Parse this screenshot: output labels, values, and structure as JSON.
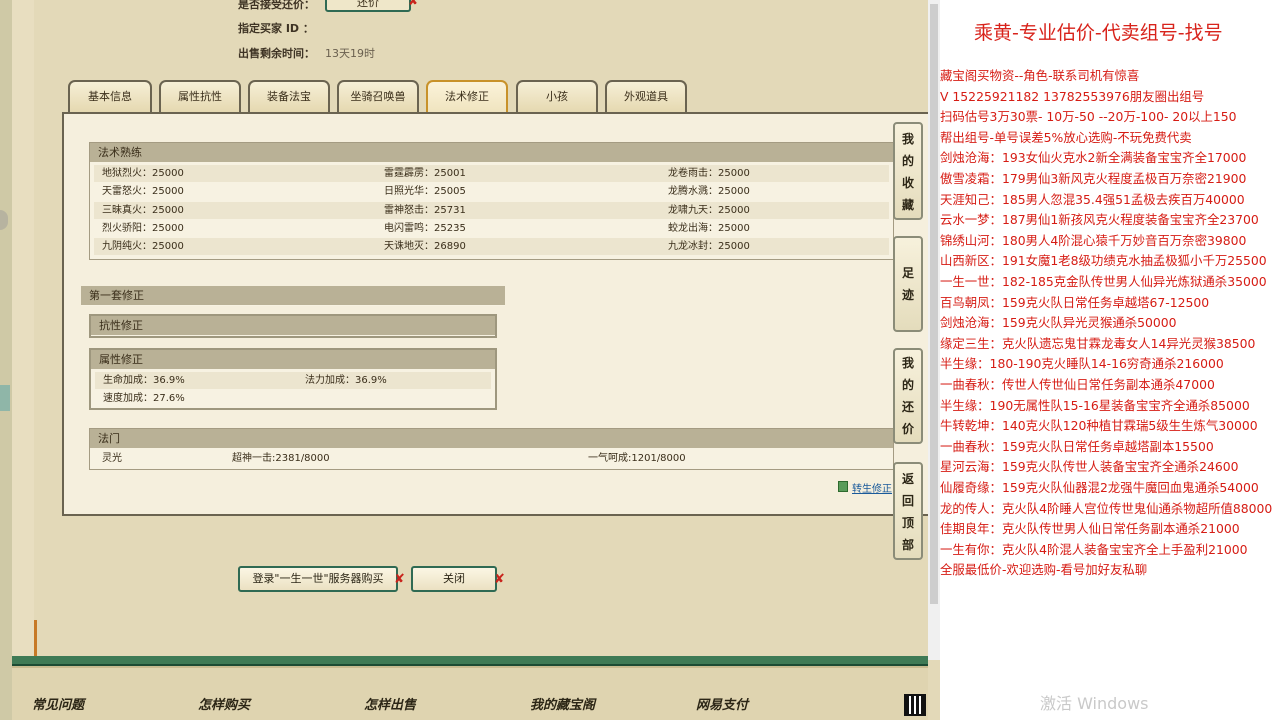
{
  "listing": {
    "accept_counter_label": "是否接受还价：",
    "counter_button": "还价",
    "buyer_id_label": "指定买家 ID ：",
    "time_left_label": "出售剩余时间：",
    "time_left_value": "13天19时"
  },
  "tabs": [
    {
      "label": "基本信息",
      "active": false
    },
    {
      "label": "属性抗性",
      "active": false
    },
    {
      "label": "装备法宝",
      "active": false
    },
    {
      "label": "坐骑召唤兽",
      "active": false
    },
    {
      "label": "法术修正",
      "active": true
    },
    {
      "label": "小孩",
      "active": false
    },
    {
      "label": "外观道具",
      "active": false
    }
  ],
  "skill_training": {
    "title": "法术熟练",
    "rows": [
      [
        "地狱烈火：25000",
        "雷霆霹雳：25001",
        "龙卷雨击：25000"
      ],
      [
        "天雷怒火：25000",
        "日照光华：25005",
        "龙腾水溅：25000"
      ],
      [
        "三昧真火：25000",
        "雷神怒击：25731",
        "龙啸九天：25000"
      ],
      [
        "烈火骄阳：25000",
        "电闪雷鸣：25235",
        "蛟龙出海：25000"
      ],
      [
        "九阴纯火：25000",
        "天诛地灭：26890",
        "九龙冰封：25000"
      ]
    ]
  },
  "correction_set": {
    "title": "第一套修正",
    "resist_title": "抗性修正",
    "attr_title": "属性修正",
    "attr_rows": [
      [
        "生命加成：36.9%",
        "法力加成：36.9%"
      ],
      [
        "速度加成：27.6%",
        ""
      ]
    ]
  },
  "fameng": {
    "title": "法门",
    "cells": [
      "灵光",
      "超神一击:2381/8000",
      "一气呵成:1201/8000"
    ]
  },
  "calc_link": "转生修正",
  "side_buttons": [
    "我的收藏",
    "足迹",
    "我的还价",
    "返回顶部"
  ],
  "buttons": {
    "login_buy": "登录\"一生一世\"服务器购买",
    "close": "关闭"
  },
  "footer_links": [
    "常见问题",
    "怎样购买",
    "怎样出售",
    "我的藏宝阁",
    "网易支付"
  ],
  "ad": {
    "title": "乘黄-专业估价-代卖组号-找号",
    "lines": [
      "藏宝阁买物资--角色-联系司机有惊喜",
      "V 15225921182  13782553976朋友圈出组号",
      "扫码估号3万30票- 10万-50 --20万-100- 20以上150",
      "帮出组号-单号误差5%放心选购-不玩免费代卖",
      "剑烛沧海：193女仙火克水2新全满装备宝宝齐全17000",
      "傲雪凌霜：179男仙3新风克火程度孟极百万奈密21900",
      "天涯知己：185男人忽混35.4强51孟极去疾百万40000",
      "云水一梦：187男仙1新孩风克火程度装备宝宝齐全23700",
      "锦绣山河：180男人4阶混心猿千万妙音百万奈密39800",
      "山西新区：191女魔1老8级功绩克水抽孟极狐小千万25500",
      "一生一世：182-185克金队传世男人仙异光炼狱通杀35000",
      "百鸟朝凤：159克火队日常任务卓越塔67-12500",
      "剑烛沧海：159克火队异光灵猴通杀50000",
      "缘定三生：克火队遗忘鬼甘霖龙毒女人14异光灵猴38500",
      "半生缘：180-190克火睡队14-16穷奇通杀216000",
      "一曲春秋：传世人传世仙日常任务副本通杀47000",
      "半生缘：190无属性队15-16星装备宝宝齐全通杀85000",
      "牛转乾坤：140克火队120种植甘霖瑞5级生生炼气30000",
      "一曲春秋：159克火队日常任务卓越塔副本15500",
      "星河云海：159克火队传世人装备宝宝齐全通杀24600",
      "仙履奇缘：159克火队仙器混2龙强牛魔回血鬼通杀54000",
      "龙的传人：克火队4阶睡人宫位传世鬼仙通杀物超所值88000",
      "佳期良年：克火队传世男人仙日常任务副本通杀21000",
      "一生有你：克火队4阶混人装备宝宝齐全上手盈利21000",
      "全服最低价-欢迎选购-看号加好友私聊"
    ],
    "watermark": "激活 Windows"
  },
  "colors": {
    "ad_red": "#d61c14",
    "panel_bg": "#f5efdd",
    "section_header": "#b9b196",
    "button_border": "#2f6a53",
    "active_tab_border": "#c8922a"
  }
}
